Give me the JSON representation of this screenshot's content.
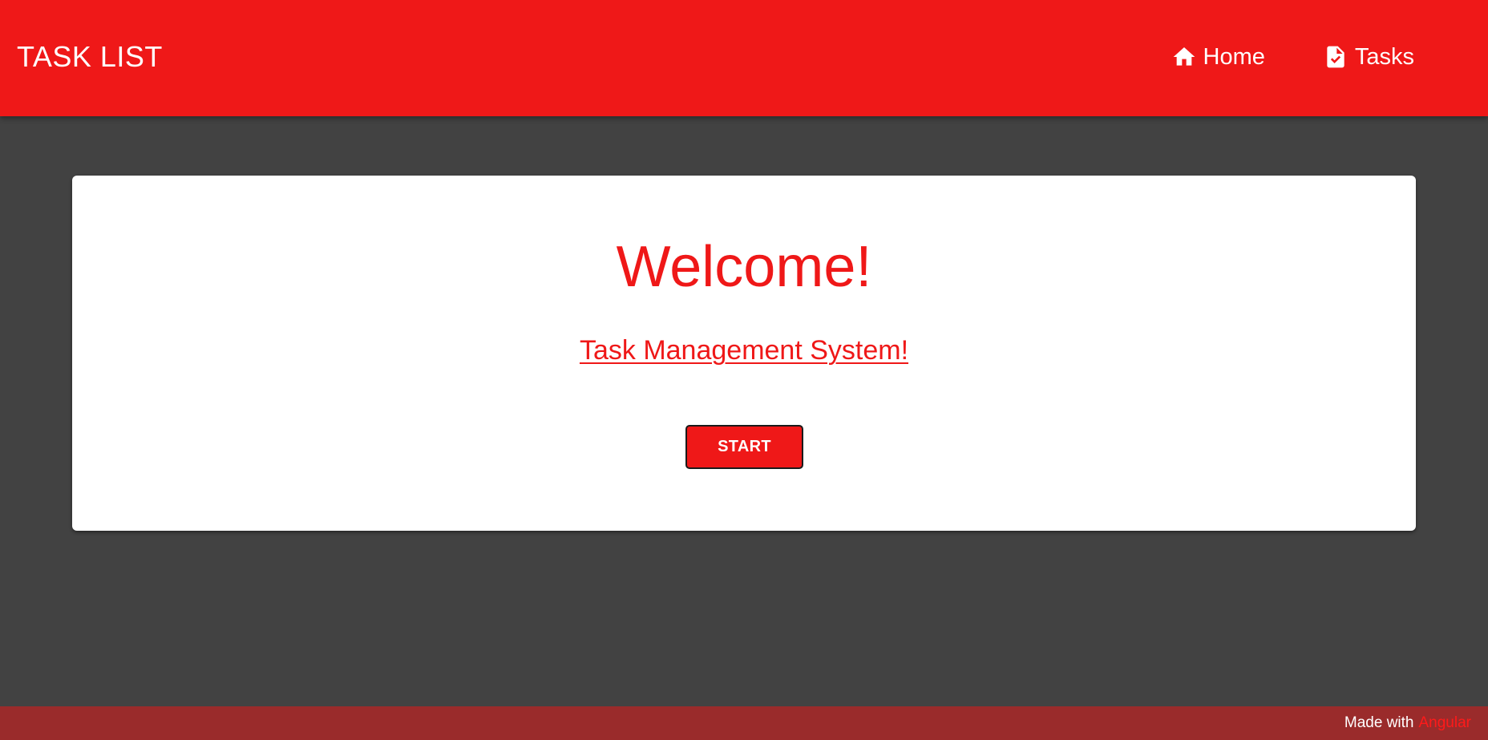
{
  "header": {
    "brand": "TASK LIST",
    "nav": [
      {
        "label": "Home",
        "icon": "home-icon"
      },
      {
        "label": "Tasks",
        "icon": "task-document-icon"
      }
    ]
  },
  "main": {
    "welcome": "Welcome!",
    "subtitle": "Task Management System!",
    "start_label": "START"
  },
  "footer": {
    "made_with": "Made with",
    "framework": "Angular"
  },
  "colors": {
    "accent": "#ef1818",
    "background": "#424242",
    "card": "#ffffff",
    "footer": "#9a2b2b"
  }
}
